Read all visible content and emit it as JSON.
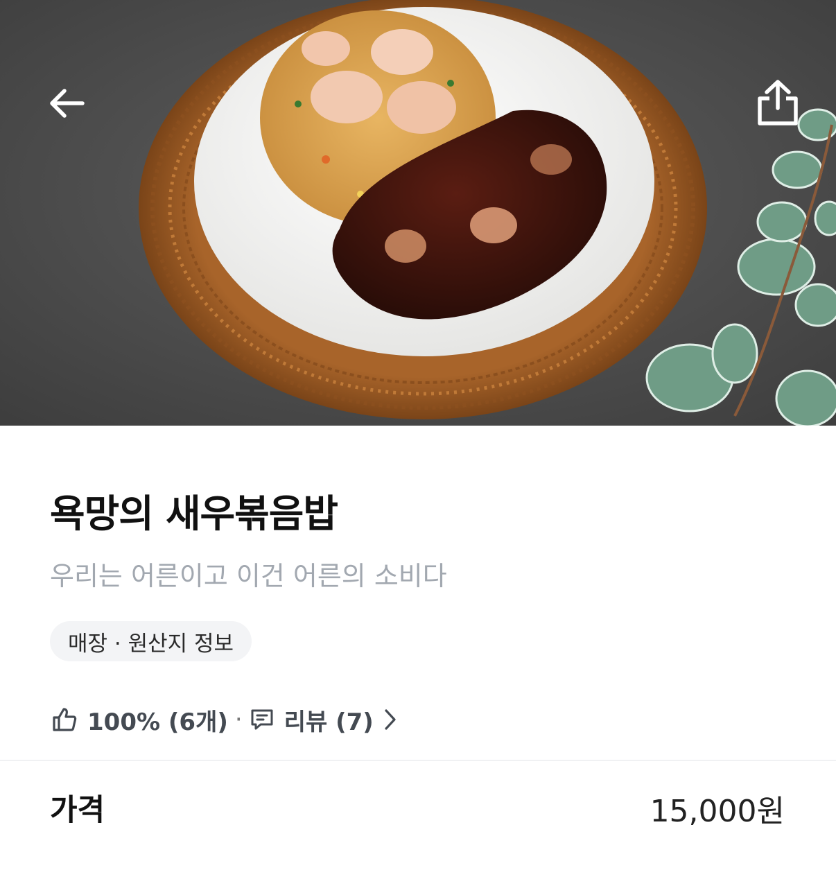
{
  "header": {
    "back_icon": "arrow-left-icon",
    "share_icon": "share-icon"
  },
  "menu": {
    "name": "욕망의 새우볶음밥",
    "description": "우리는 어른이고 이건 어른의 소비다",
    "info_chip_label": "매장 · 원산지 정보"
  },
  "stats": {
    "like_icon": "thumbs-up-icon",
    "like_text": "100% (6개)",
    "separator": "·",
    "review_icon": "comment-icon",
    "review_text": "리뷰 (7)",
    "chevron_icon": "chevron-right-icon"
  },
  "price": {
    "label": "가격",
    "value": "15,000원"
  },
  "colors": {
    "subtitle": "#a2a8b0",
    "chip_bg": "#f3f4f6",
    "stats_text": "#444a52"
  }
}
